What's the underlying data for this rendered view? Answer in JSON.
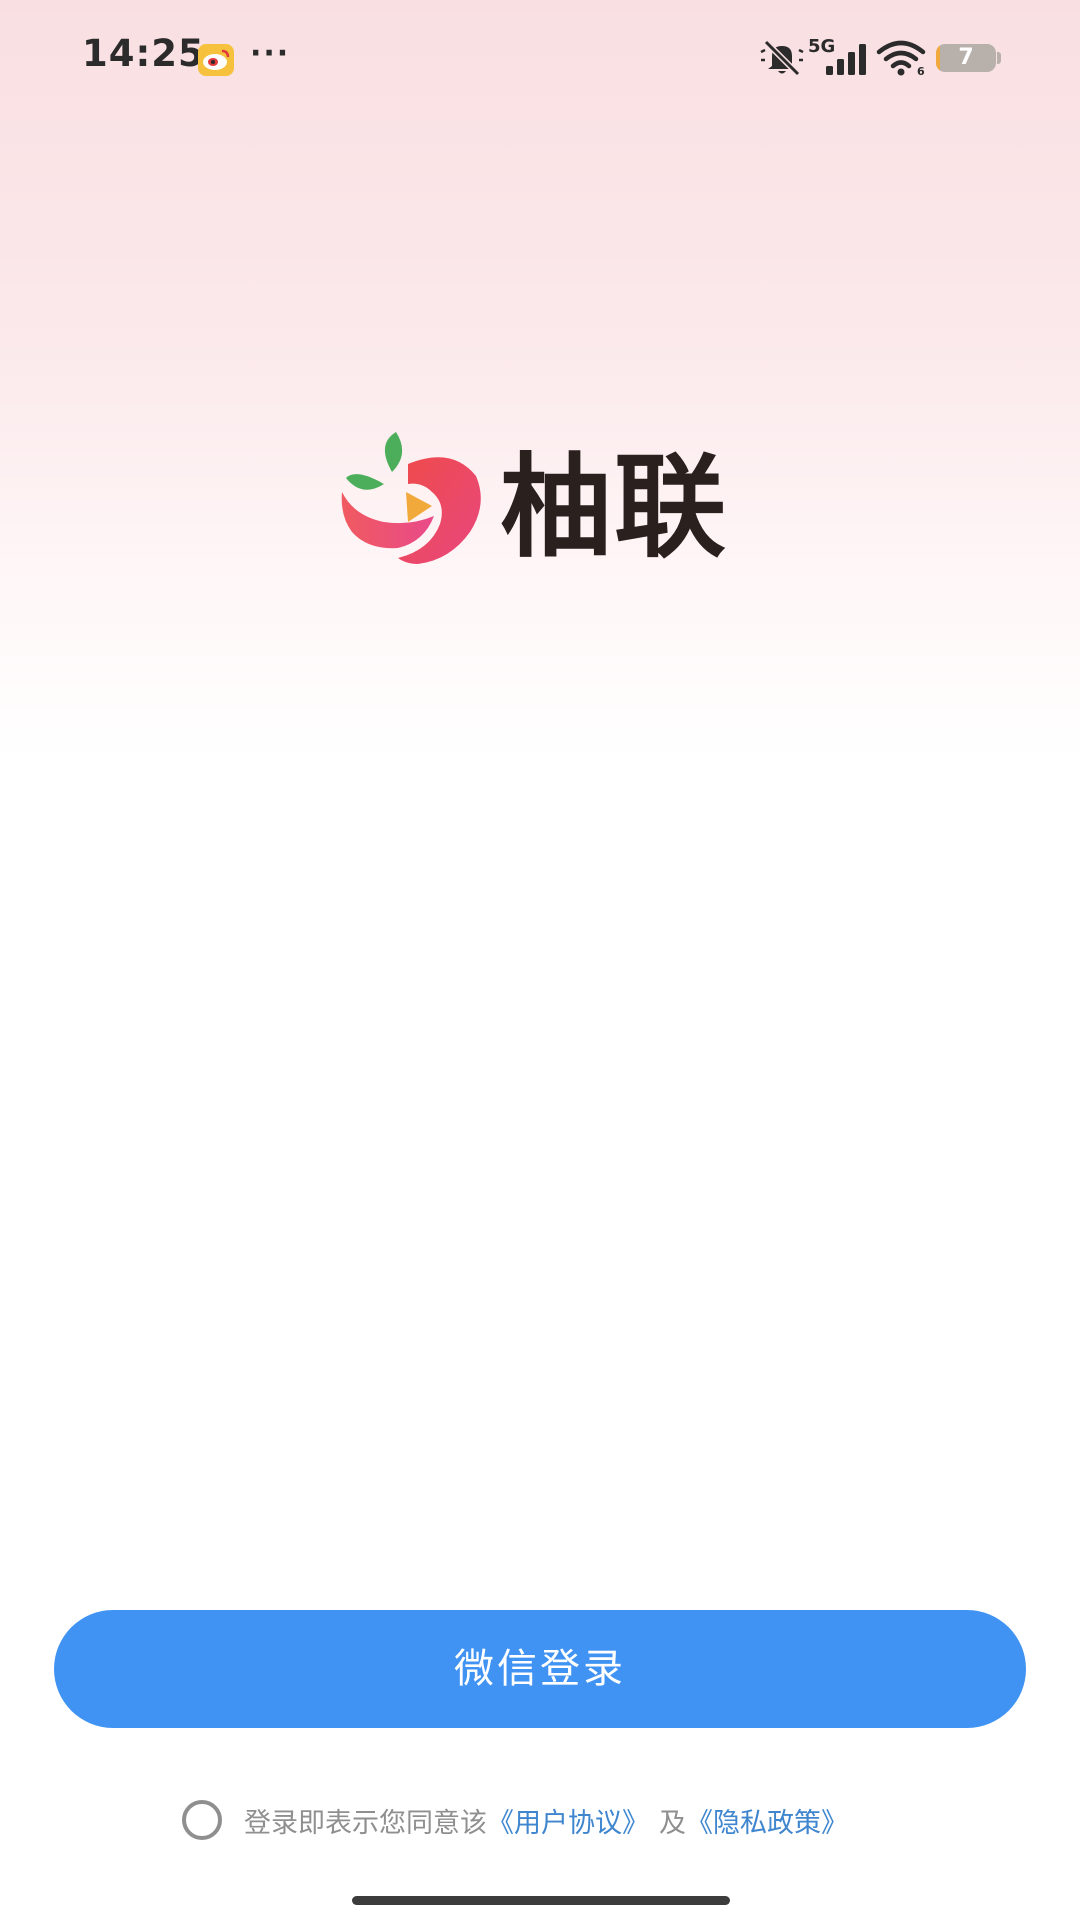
{
  "status_bar": {
    "time": "14:25",
    "more": "···",
    "network": "5G",
    "battery_level": "7",
    "battery_fraction": 0.07,
    "icons": [
      "weibo-app-icon",
      "mute-icon",
      "signal-icon",
      "wifi-icon",
      "battery-icon"
    ]
  },
  "brand": {
    "name": "柚联",
    "logo_icon": "yoolian-fruit-play-logo"
  },
  "login": {
    "wechat_button_label": "微信登录"
  },
  "agreement": {
    "prefix": "登录即表示您同意该",
    "user_agreement": "《用户协议》",
    "joiner": "及",
    "privacy_policy": "《隐私政策》"
  },
  "colors": {
    "primary_button": "#4193f3",
    "link": "#3f86cf",
    "muted_text": "#8f8f8f",
    "brand_text": "#2a201e",
    "background_top": "#f9dfe2"
  }
}
